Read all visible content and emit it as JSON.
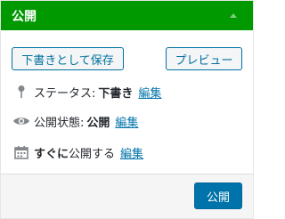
{
  "panel": {
    "title": "公開"
  },
  "buttons": {
    "save_draft": "下書きとして保存",
    "preview": "プレビュー",
    "publish": "公開"
  },
  "status": {
    "label": "ステータス:",
    "value": "下書き",
    "edit": "編集"
  },
  "visibility": {
    "label": "公開状態:",
    "value": "公開",
    "edit": "編集"
  },
  "schedule": {
    "label": "すぐに",
    "label_rest": "公開する",
    "edit": "編集"
  },
  "colors": {
    "header": "#009a00",
    "link": "#0073aa",
    "primary": "#0073aa"
  }
}
